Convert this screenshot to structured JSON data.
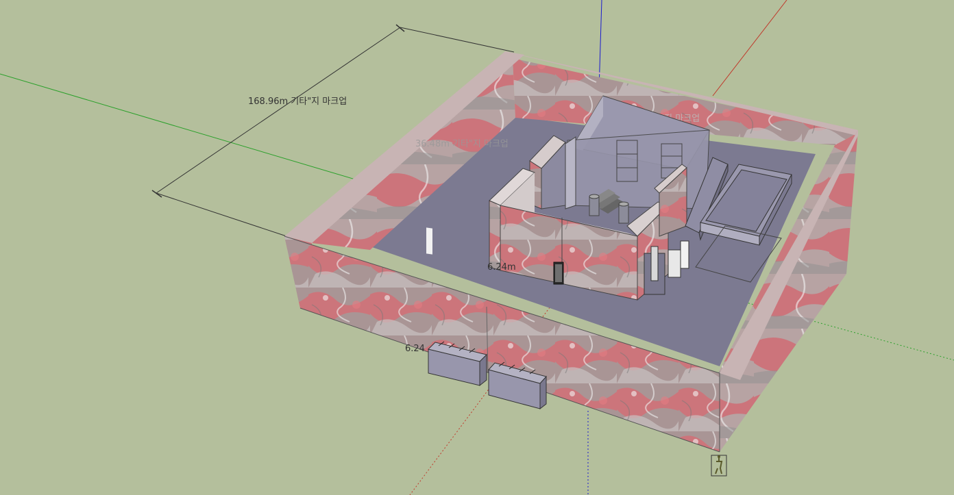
{
  "app": {
    "viewport": "3D model viewport",
    "background_color": "#b4bf9c"
  },
  "axes": {
    "red": "#c0392b",
    "green": "#2aa02a",
    "blue": "#1a1ad0"
  },
  "dimensions": {
    "outer_length": "168.96m 기타\"지 마크업",
    "inner_length_1": "156.48m 기타\"지 마크업",
    "inner_length_2": "36.48m 기타\"지 마크업",
    "wall_thickness_1": "6.24m",
    "wall_thickness_2": "6.24"
  },
  "materials": {
    "wall_texture_base": "#b98686",
    "wall_texture_red": "#d9646a",
    "floor": "#7c7a91",
    "cutaway": "#9a98ae"
  }
}
